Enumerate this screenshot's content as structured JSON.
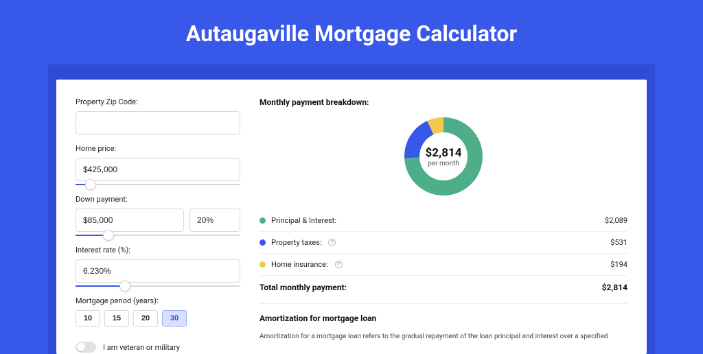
{
  "title": "Autaugaville Mortgage Calculator",
  "left": {
    "zip_label": "Property Zip Code:",
    "zip_value": "",
    "home_price_label": "Home price:",
    "home_price_value": "$425,000",
    "home_price_slider_pct": 9,
    "down_payment_label": "Down payment:",
    "down_payment_value": "$85,000",
    "down_payment_pct_value": "20%",
    "down_payment_slider_pct": 20,
    "interest_label": "Interest rate (%):",
    "interest_value": "6.230%",
    "interest_slider_pct": 30,
    "period_label": "Mortgage period (years):",
    "periods": [
      "10",
      "15",
      "20",
      "30"
    ],
    "period_active": "30",
    "veteran_label": "I am veteran or military"
  },
  "right": {
    "breakdown_title": "Monthly payment breakdown:",
    "center_amount": "$2,814",
    "center_sub": "per month",
    "rows": [
      {
        "color": "green",
        "label": "Principal & Interest:",
        "value": "$2,089",
        "info": false
      },
      {
        "color": "blue",
        "label": "Property taxes:",
        "value": "$531",
        "info": true
      },
      {
        "color": "yellow",
        "label": "Home insurance:",
        "value": "$194",
        "info": true
      }
    ],
    "total_label": "Total monthly payment:",
    "total_value": "$2,814",
    "amort_title": "Amortization for mortgage loan",
    "amort_text": "Amortization for a mortgage loan refers to the gradual repayment of the loan principal and interest over a specified"
  },
  "chart_data": {
    "type": "pie",
    "title": "Monthly payment breakdown",
    "series": [
      {
        "name": "Principal & Interest",
        "value": 2089,
        "color": "#4fae8a"
      },
      {
        "name": "Property taxes",
        "value": 531,
        "color": "#3858e9"
      },
      {
        "name": "Home insurance",
        "value": 194,
        "color": "#f2c94c"
      }
    ],
    "total": 2814,
    "center_label": "$2,814 per month"
  }
}
